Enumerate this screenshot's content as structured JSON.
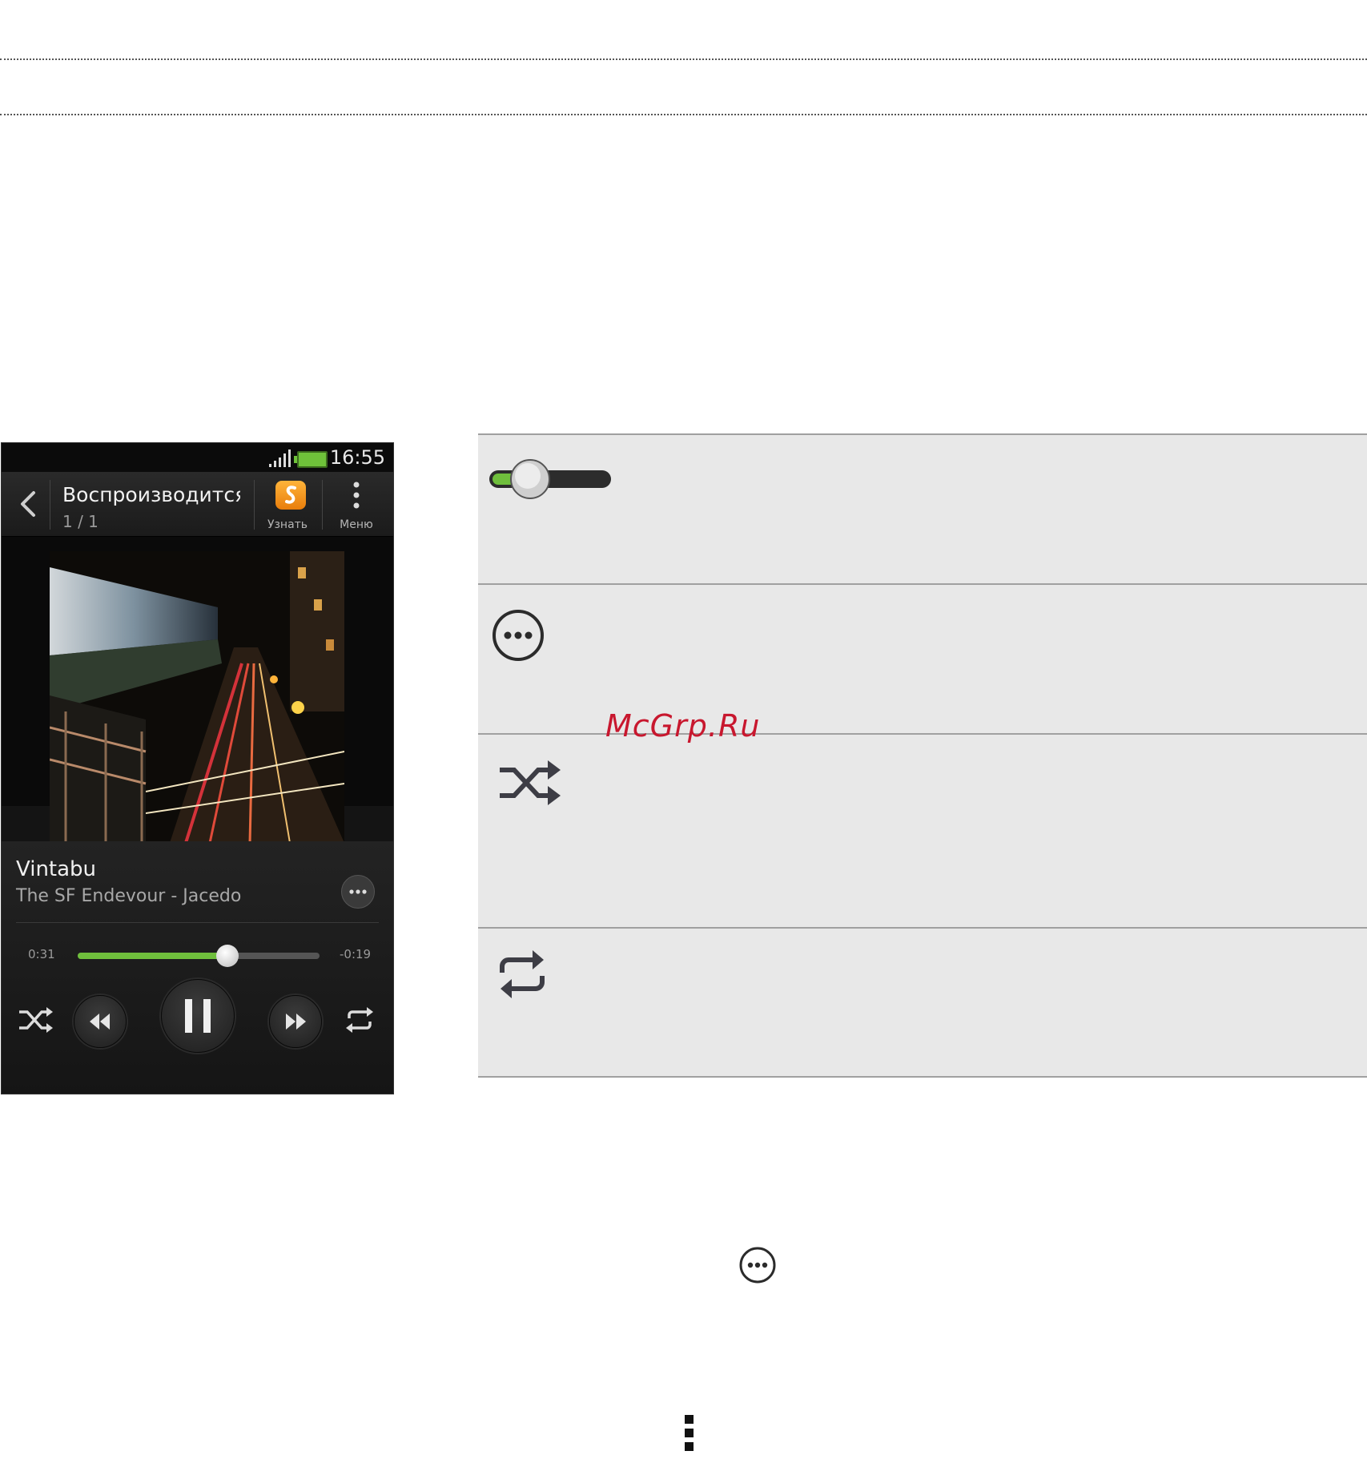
{
  "phone": {
    "status": {
      "time": "16:55"
    },
    "actionbar": {
      "title": "Воспроизводится",
      "subtitle": "1 / 1",
      "identify_label": "Узнать",
      "menu_label": "Меню"
    },
    "track": {
      "title": "Vintabu",
      "artist_album": "The SF Endevour - Jacedo",
      "elapsed": "0:31",
      "remaining": "-0:19",
      "progress_fraction": 0.62
    }
  },
  "watermark": "McGrp.Ru",
  "icons": [
    "volume-slider-icon",
    "more-options-icon",
    "shuffle-icon",
    "repeat-icon",
    "menu-dots-icon"
  ],
  "colors": {
    "accent_green": "#6fbf3c",
    "watermark_red": "#c8172e",
    "row_bg": "#e8e8e8"
  }
}
